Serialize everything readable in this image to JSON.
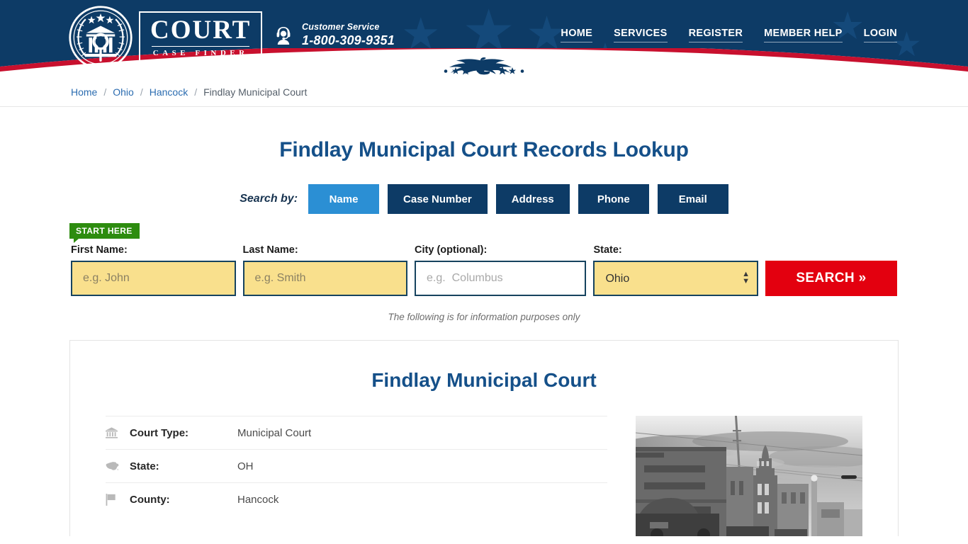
{
  "header": {
    "logo": {
      "icon": "court-seal-icon",
      "wordmark_main": "COURT",
      "wordmark_sub": "CASE FINDER"
    },
    "customer_service": {
      "icon": "headset-support-icon",
      "label": "Customer Service",
      "phone": "1-800-309-9351"
    },
    "nav": [
      {
        "label": "HOME"
      },
      {
        "label": "SERVICES"
      },
      {
        "label": "REGISTER"
      },
      {
        "label": "MEMBER HELP"
      },
      {
        "label": "LOGIN"
      }
    ],
    "colors": {
      "navy": "#0d3b66",
      "red": "#c8102e",
      "star": "#14497a"
    }
  },
  "breadcrumb": {
    "separator": "/",
    "items": [
      {
        "label": "Home",
        "current": false
      },
      {
        "label": "Ohio",
        "current": false
      },
      {
        "label": "Hancock",
        "current": false
      },
      {
        "label": "Findlay Municipal Court",
        "current": true
      }
    ]
  },
  "search": {
    "title": "Findlay Municipal Court Records Lookup",
    "search_by_label": "Search by:",
    "tabs": [
      {
        "label": "Name",
        "active": true
      },
      {
        "label": "Case Number",
        "active": false
      },
      {
        "label": "Address",
        "active": false
      },
      {
        "label": "Phone",
        "active": false
      },
      {
        "label": "Email",
        "active": false
      }
    ],
    "start_here_badge": "START HERE",
    "fields": {
      "first_name": {
        "label": "First Name:",
        "placeholder": "e.g. John",
        "value": ""
      },
      "last_name": {
        "label": "Last Name:",
        "placeholder": "e.g. Smith",
        "value": ""
      },
      "city": {
        "label": "City (optional):",
        "placeholder": "e.g.  Columbus",
        "value": ""
      },
      "state": {
        "label": "State:",
        "selected": "Ohio",
        "options": [
          "Ohio"
        ]
      }
    },
    "search_button": "SEARCH »",
    "info_note": "The following is for information purposes only",
    "colors": {
      "tab_active": "#2b8fd4",
      "tab_inactive": "#0d3b66",
      "input_highlight": "#f9e08d",
      "search_button": "#e3000f",
      "badge_green": "#2d8c0f"
    }
  },
  "court": {
    "name": "Findlay Municipal Court",
    "details": [
      {
        "icon": "bank-building-icon",
        "label": "Court Type:",
        "value": "Municipal Court"
      },
      {
        "icon": "us-map-icon",
        "label": "State:",
        "value": "OH"
      },
      {
        "icon": "flag-icon",
        "label": "County:",
        "value": "Hancock"
      }
    ],
    "photo": {
      "name": "courthouse-street-photo",
      "alt": "Findlay Municipal Court building street view"
    }
  }
}
